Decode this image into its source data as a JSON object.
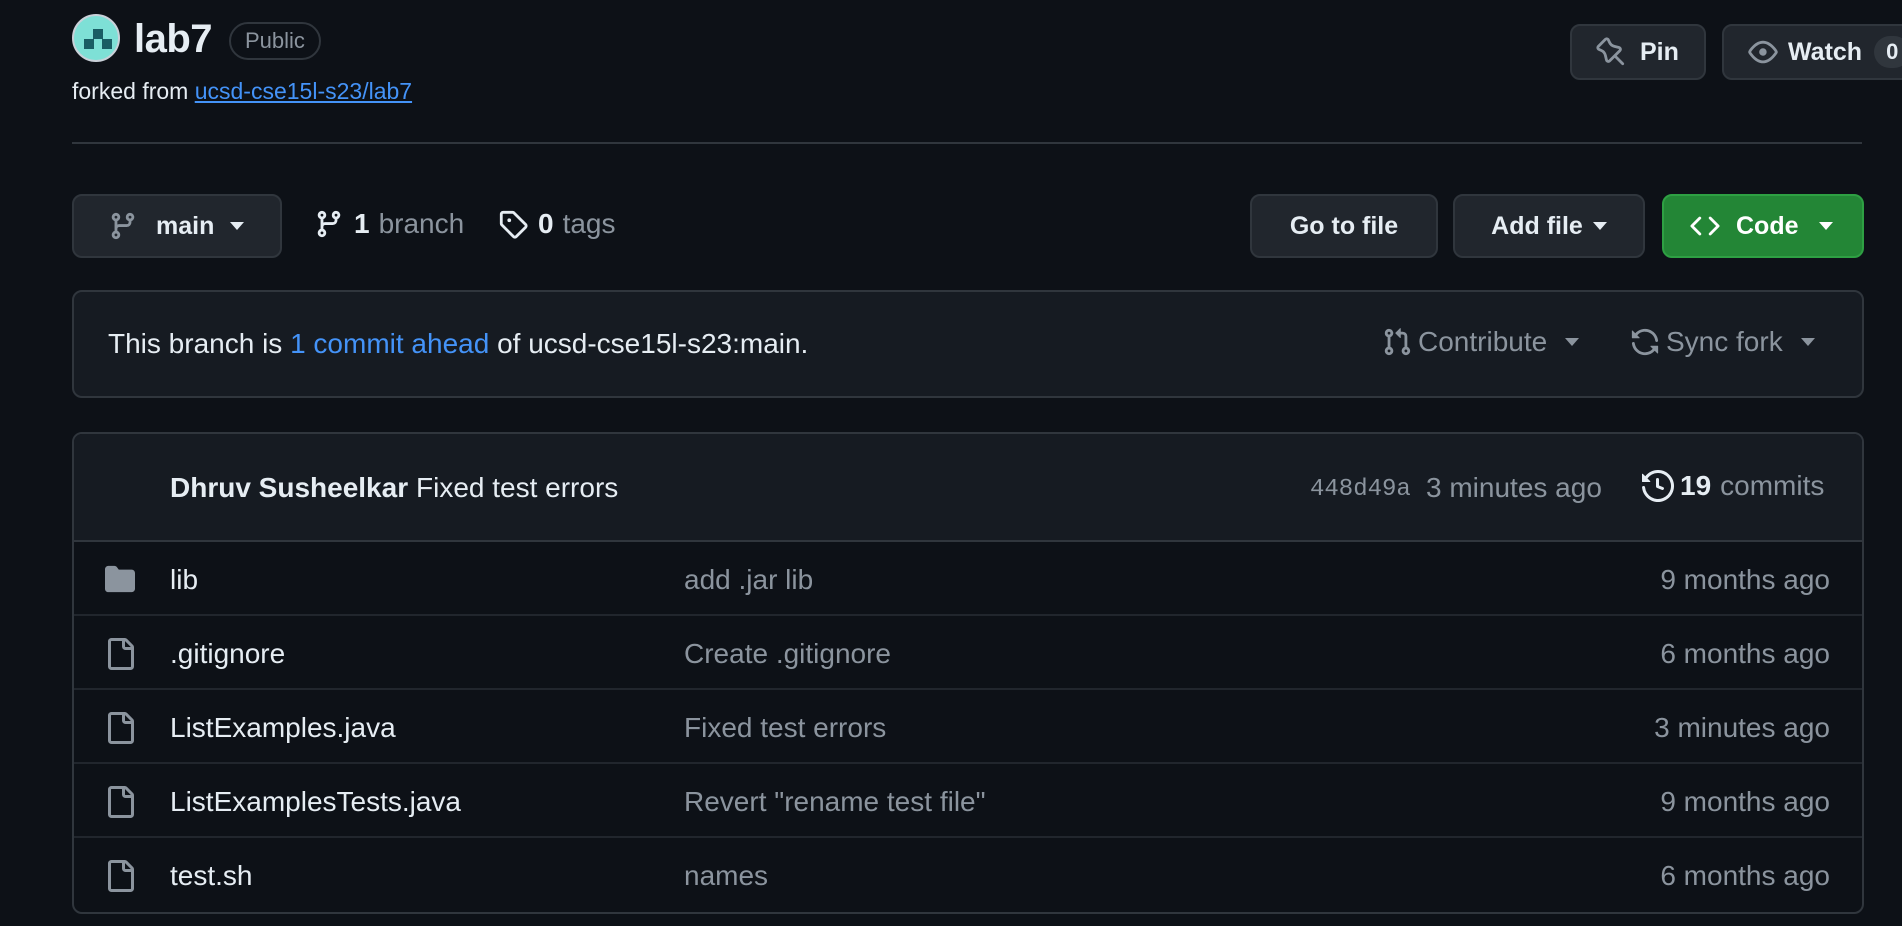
{
  "repo": {
    "name": "lab7",
    "visibility": "Public",
    "forked_prefix": "forked from",
    "forked_from": "ucsd-cse15l-s23/lab7"
  },
  "header_actions": {
    "pin_label": "Pin",
    "watch_label": "Watch",
    "watch_count": "0"
  },
  "toolbar": {
    "branch_name": "main",
    "branch_count": "1",
    "branch_label": "branch",
    "tag_count": "0",
    "tag_label": "tags",
    "goto_file_label": "Go to file",
    "add_file_label": "Add file",
    "code_label": "Code"
  },
  "fork_status": {
    "prefix": "This branch is",
    "ahead_text": "1 commit ahead",
    "suffix": "of ucsd-cse15l-s23:main.",
    "contribute_label": "Contribute",
    "sync_label": "Sync fork"
  },
  "latest_commit": {
    "author": "Dhruv Susheelkar",
    "message": "Fixed test errors",
    "sha": "448d49a",
    "time": "3 minutes ago",
    "commit_count": "19",
    "commit_label": "commits"
  },
  "files": [
    {
      "type": "folder",
      "name": "lib",
      "message": "add .jar lib",
      "age": "9 months ago"
    },
    {
      "type": "file",
      "name": ".gitignore",
      "message": "Create .gitignore",
      "age": "6 months ago"
    },
    {
      "type": "file",
      "name": "ListExamples.java",
      "message": "Fixed test errors",
      "age": "3 minutes ago"
    },
    {
      "type": "file",
      "name": "ListExamplesTests.java",
      "message": "Revert \"rename test file\"",
      "age": "9 months ago"
    },
    {
      "type": "file",
      "name": "test.sh",
      "message": "names",
      "age": "6 months ago"
    }
  ],
  "colors": {
    "background": "#0d1117",
    "link": "#4493f8",
    "code_button": "#238636",
    "muted_text": "#8b949e"
  }
}
